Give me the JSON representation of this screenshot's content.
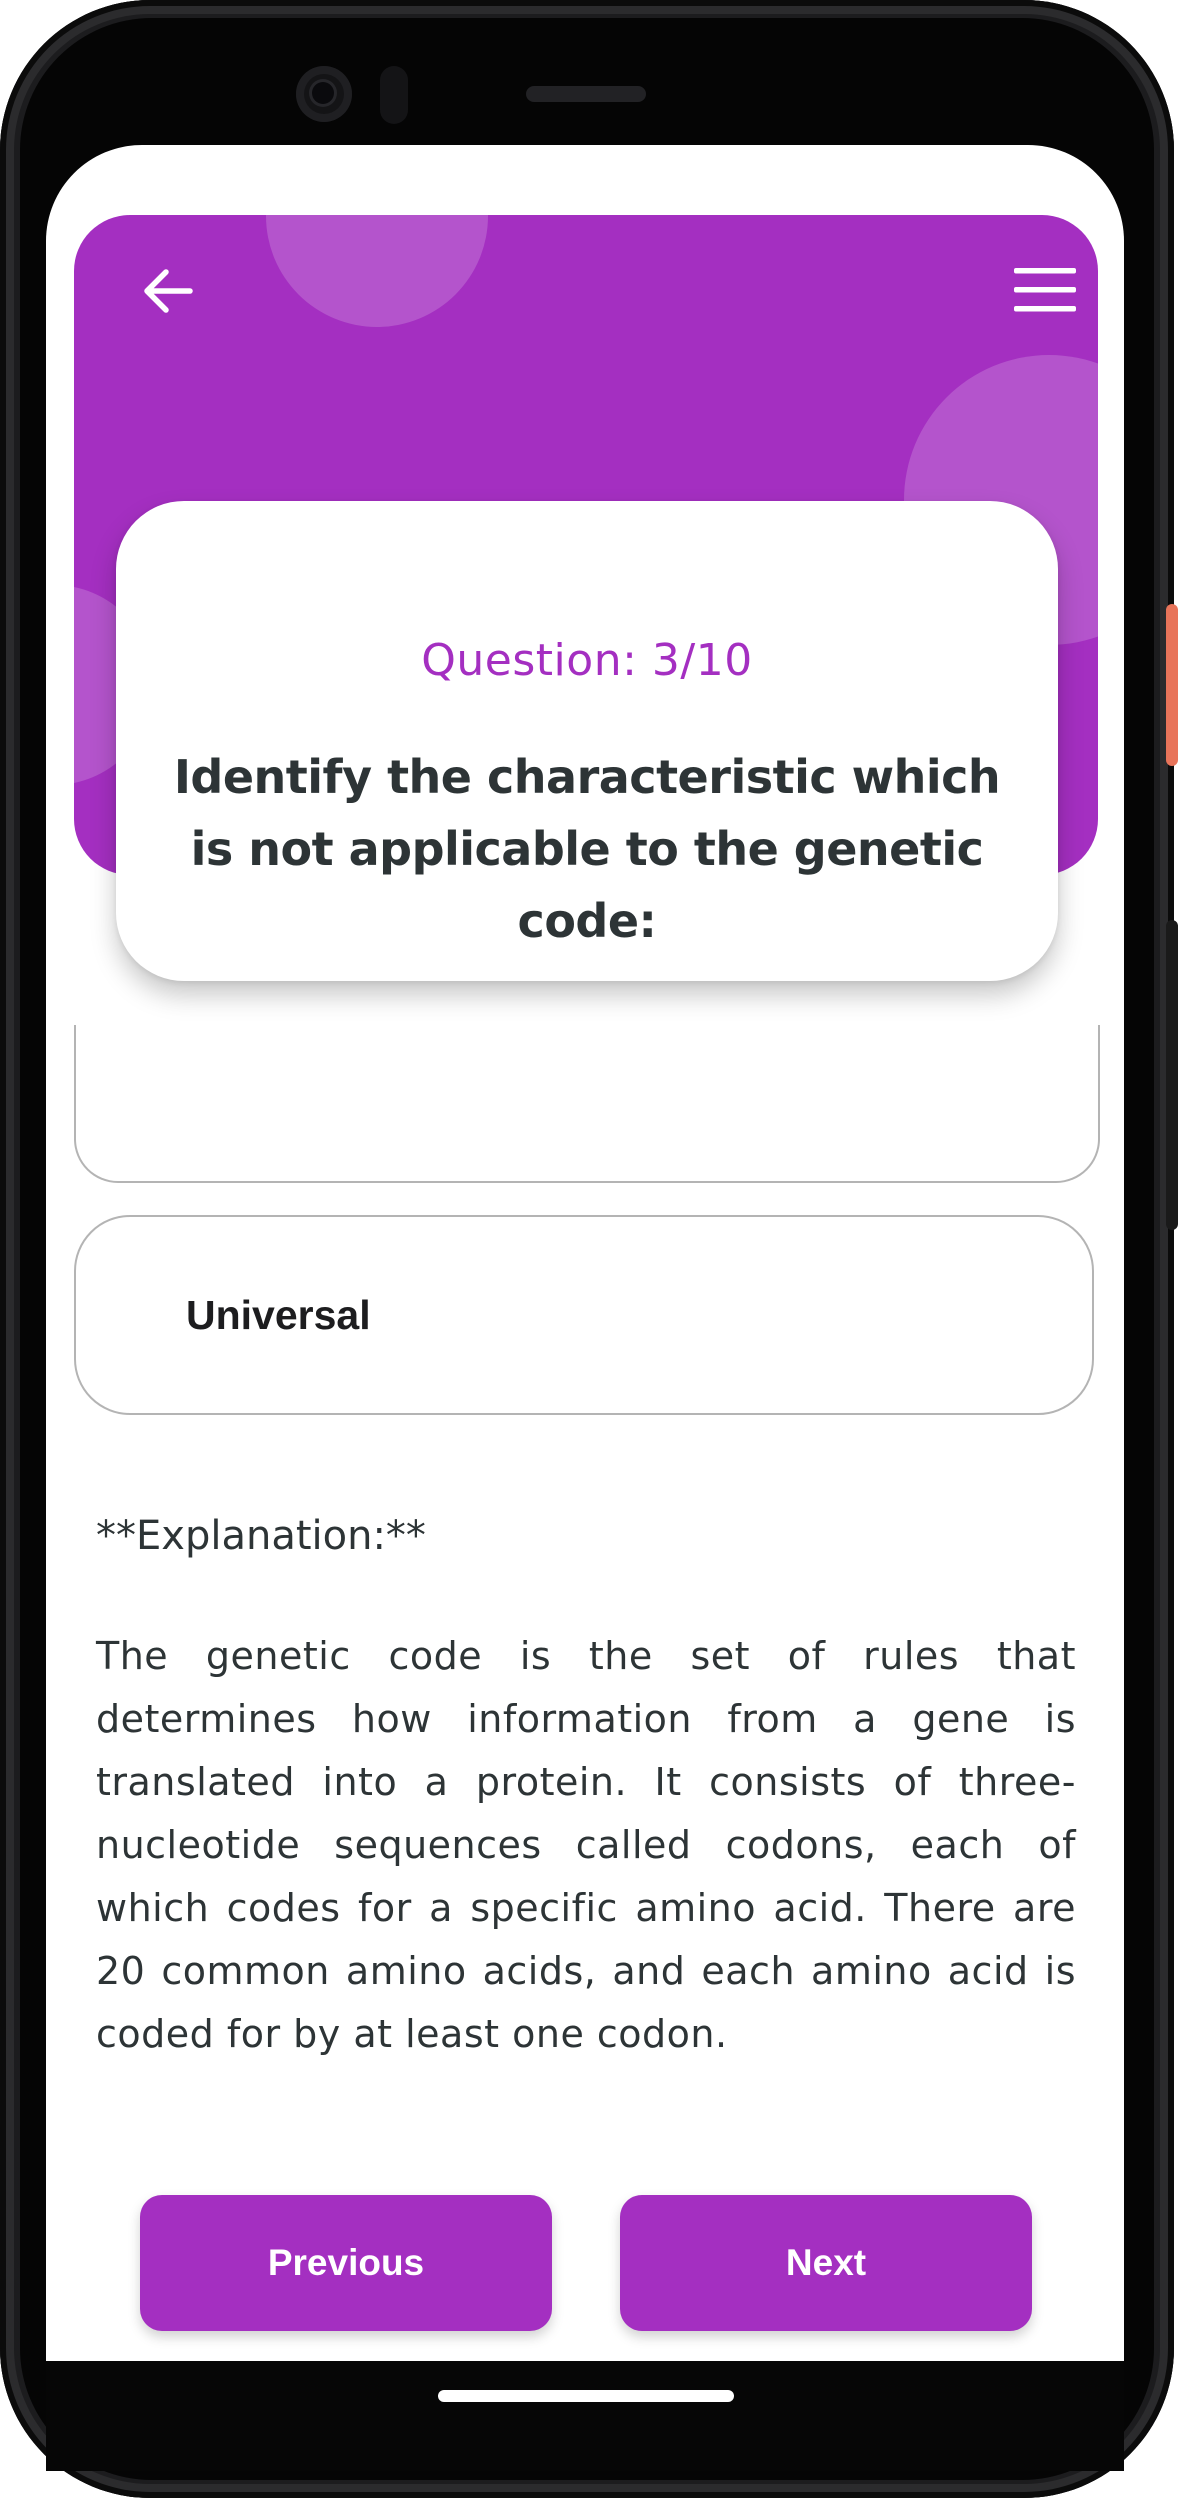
{
  "colors": {
    "accent": "#a42fc1",
    "text": "#2d3436",
    "border": "#b4b4b4"
  },
  "header": {
    "back_icon": "arrow-left-icon",
    "menu_icon": "hamburger-menu-icon"
  },
  "question": {
    "counter": "Question: 3/10",
    "text": "Identify the characteristic which is not applicable to the genetic code:"
  },
  "options": [
    {
      "label": "Universal"
    }
  ],
  "explanation": {
    "title": "**Explanation:**",
    "body": "The genetic code is the set of rules that determines how information from a gene is translated into a protein. It consists of three-nucleotide sequences called codons, each of which codes for a specific amino acid. There are 20 common amino acids, and each amino acid is coded for by at least one codon."
  },
  "navigation": {
    "previous_label": "Previous",
    "next_label": "Next"
  }
}
